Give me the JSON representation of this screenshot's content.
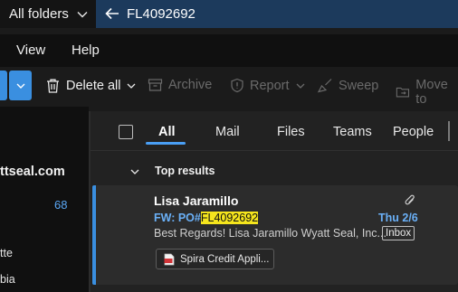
{
  "search": {
    "scope": "All folders",
    "query": "FL4092692"
  },
  "menu": {
    "items": [
      "View",
      "Help"
    ]
  },
  "toolbar": {
    "delete_all": "Delete all",
    "archive": "Archive",
    "report": "Report",
    "sweep": "Sweep",
    "move_to": "Move to"
  },
  "folders": {
    "account": "ttseal.com",
    "inbox_count": "68",
    "row1": "tte",
    "row2": "bia"
  },
  "tabs": {
    "all": "All",
    "mail": "Mail",
    "files": "Files",
    "teams": "Teams",
    "people": "People"
  },
  "results": {
    "section_title": "Top results",
    "item": {
      "sender": "Lisa Jaramillo",
      "subject_prefix": "FW: PO#",
      "subject_highlight": "FL4092692",
      "date": "Thu 2/6",
      "preview": "Best Regards! Lisa Jaramillo Wyatt Seal, Inc...",
      "folder_badge": "Inbox",
      "attachment_name": "Spira Credit Appli..."
    }
  },
  "colors": {
    "accent": "#3a8fe0",
    "link": "#6ab0f7",
    "highlight": "#f5e51d",
    "search_bar": "#1c3a5c"
  }
}
